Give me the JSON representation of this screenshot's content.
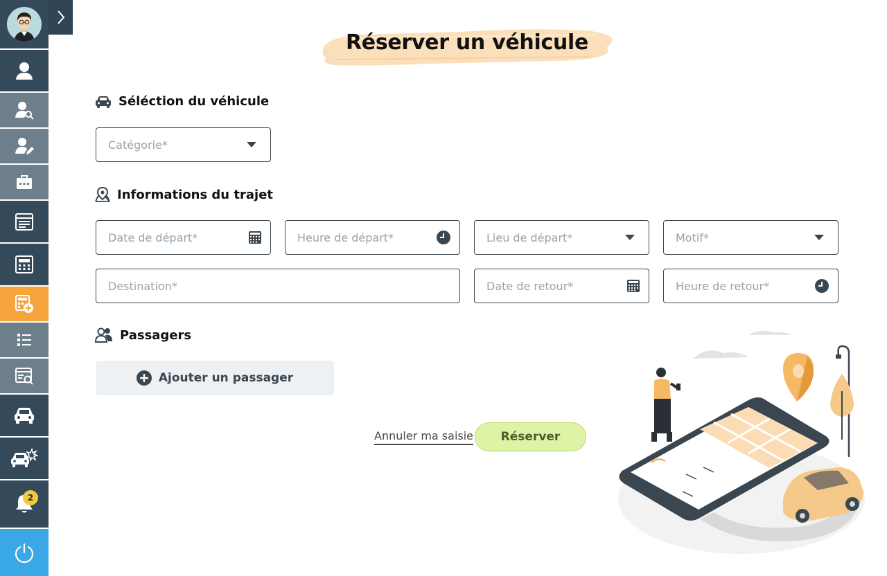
{
  "page": {
    "title": "Réserver un véhicule"
  },
  "sections": {
    "vehicle": {
      "title": "Séléction du véhicule",
      "category_placeholder": "Catégorie*"
    },
    "trip": {
      "title": "Informations du trajet",
      "departure_date_placeholder": "Date de départ*",
      "departure_time_placeholder": "Heure de départ*",
      "departure_place_placeholder": "Lieu de départ*",
      "reason_placeholder": "Motif*",
      "destination_placeholder": "Destination*",
      "return_date_placeholder": "Date de retour*",
      "return_time_placeholder": "Heure de retour*"
    },
    "passengers": {
      "title": "Passagers",
      "add_label": "Ajouter un passager"
    }
  },
  "actions": {
    "cancel_label": "Annuler ma saisie",
    "submit_label": "Réserver"
  },
  "sidebar": {
    "notifications_count": "2",
    "items": [
      {
        "icon": "user-icon"
      },
      {
        "icon": "user-search-icon"
      },
      {
        "icon": "user-edit-icon"
      },
      {
        "icon": "briefcase-icon"
      },
      {
        "icon": "calendar-icon"
      },
      {
        "icon": "calculator-icon"
      },
      {
        "icon": "calculator-add-icon"
      },
      {
        "icon": "list-icon"
      },
      {
        "icon": "document-search-icon"
      },
      {
        "icon": "car-icon"
      },
      {
        "icon": "car-crash-icon"
      },
      {
        "icon": "bell-icon"
      },
      {
        "icon": "power-icon"
      }
    ]
  },
  "colors": {
    "sidebar_dark": "#34495a",
    "sidebar_light": "#6e7f8c",
    "sidebar_active": "#f5a53b",
    "sidebar_power": "#3aa8e6",
    "submit_bg": "#dff3a6",
    "title_brush": "#fbdcb4"
  }
}
